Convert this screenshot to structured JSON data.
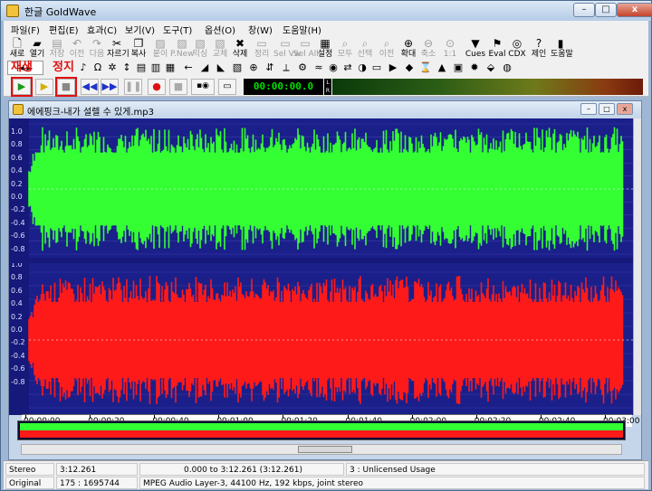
{
  "window": {
    "title": "한글 GoldWave",
    "min": "–",
    "max": "□",
    "close": "x"
  },
  "menu": [
    "파일(F)",
    "편집(E)",
    "효과(C)",
    "보기(V)",
    "도구(T)",
    "옵션(O)",
    "창(W)",
    "도움말(H)"
  ],
  "toolbar_top": [
    {
      "label": "새로",
      "icon": "new-file-icon"
    },
    {
      "label": "열기",
      "icon": "open-folder-icon"
    },
    {
      "label": "저장",
      "icon": "save-icon",
      "dim": true
    },
    {
      "label": "이전",
      "icon": "undo-icon",
      "dim": true
    },
    {
      "label": "다음",
      "icon": "redo-icon",
      "dim": true
    },
    {
      "label": "자르기",
      "icon": "cut-icon"
    },
    {
      "label": "복사",
      "icon": "copy-icon"
    },
    {
      "label": "붙이",
      "icon": "paste-icon",
      "dim": true
    },
    {
      "label": "P.New",
      "icon": "paste-new-icon",
      "dim": true
    },
    {
      "label": "믹싱",
      "icon": "mix-icon",
      "dim": true
    },
    {
      "label": "교체",
      "icon": "replace-icon",
      "dim": true
    },
    {
      "label": "삭제",
      "icon": "delete-icon"
    },
    {
      "label": "정리",
      "icon": "trim-icon",
      "dim": true
    },
    {
      "label": "Sel Vw",
      "icon": "select-view-icon",
      "dim": true
    },
    {
      "label": "Sel All",
      "icon": "select-all-icon",
      "dim": true
    },
    {
      "label": "설정",
      "icon": "settings-icon"
    },
    {
      "label": "모두",
      "icon": "zoom-all-icon",
      "dim": true
    },
    {
      "label": "선택",
      "icon": "zoom-selection-icon",
      "dim": true
    },
    {
      "label": "이전",
      "icon": "zoom-previous-icon",
      "dim": true
    },
    {
      "label": "확대",
      "icon": "zoom-in-icon"
    },
    {
      "label": "축소",
      "icon": "zoom-out-icon",
      "dim": true
    },
    {
      "label": "1:1",
      "icon": "zoom-one-icon",
      "dim": true
    },
    {
      "label": "Cues",
      "icon": "cues-icon"
    },
    {
      "label": "Eval",
      "icon": "eval-icon"
    },
    {
      "label": "CDX",
      "icon": "cd-icon"
    },
    {
      "label": "제인",
      "icon": "help-icon"
    },
    {
      "label": "도움말",
      "icon": "book-icon"
    }
  ],
  "annotations": {
    "play": "재생",
    "stop": "정지"
  },
  "transport": {
    "counter": "00:00:00.0"
  },
  "document": {
    "title": "에에핑크-내가 설렐 수 있게.mp3"
  },
  "scale_labels": [
    "1.0",
    "0.8",
    "0.6",
    "0.4",
    "0.2",
    "0.0",
    "-0.2",
    "-0.4",
    "-0.6",
    "-0.8",
    "1.0",
    "0.8",
    "0.6",
    "0.4",
    "0.2",
    "0.0",
    "-0.2",
    "-0.4",
    "-0.6",
    "-0.8"
  ],
  "timeline": [
    "00:00:00",
    "00:00:20",
    "00:00:40",
    "00:01:00",
    "00:01:20",
    "00:01:40",
    "00:02:00",
    "00:02:20",
    "00:02:40",
    "00:03:00"
  ],
  "status": {
    "channels": "Stereo",
    "length": "3:12.261",
    "selection": "0.000 to 3:12.261 (3:12.261)",
    "license": "3 : Unlicensed Usage",
    "state": "Original",
    "position": "175 : 1695744",
    "format": "MPEG Audio Layer-3, 44100 Hz, 192 kbps, joint stereo"
  },
  "colors": {
    "left_channel": "#33ff33",
    "right_channel": "#ff1a1a",
    "background": "#1a1f8a"
  }
}
